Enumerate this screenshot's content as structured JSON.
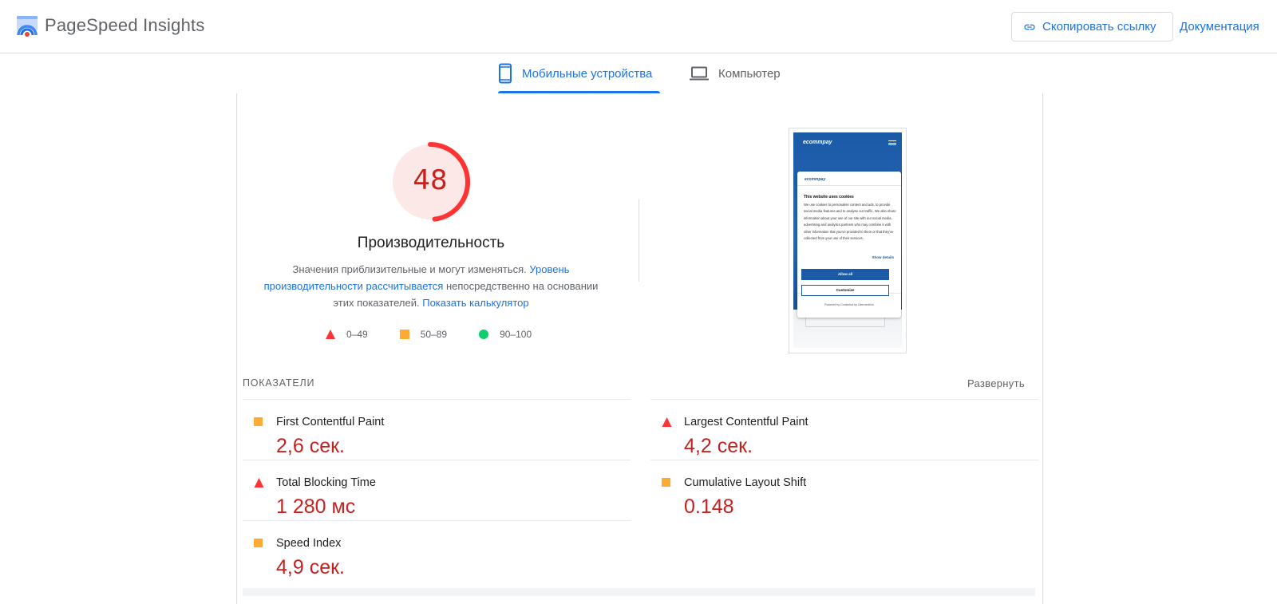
{
  "header": {
    "logo_text": "PageSpeed Insights",
    "copy_link": "Скопировать ссылку",
    "docs": "Документация"
  },
  "tabs": [
    {
      "label": "Мобильные устройства",
      "active": true,
      "icon": "phone-icon"
    },
    {
      "label": "Компьютер",
      "active": false,
      "icon": "laptop-icon"
    }
  ],
  "score": {
    "value": "48",
    "fraction": 0.48,
    "title": "Производительность",
    "desc_1": "Значения приблизительные и могут изменяться. ",
    "link_1": "Уровень производительности рассчитывается",
    "desc_2": " непосредственно на основании этих показателей. ",
    "link_2": "Показать калькулятор"
  },
  "legend": [
    {
      "label": "0–49",
      "shape": "triangle",
      "color": "#ff3333"
    },
    {
      "label": "50–89",
      "shape": "square",
      "color": "#ffaa33"
    },
    {
      "label": "90–100",
      "shape": "circle",
      "color": "#0cce6b"
    }
  ],
  "screenshot": {
    "brand": "ecommpay",
    "dialog_title": "This website uses cookies",
    "dialog_body": "We use cookies to personalise content and ads, to provide social media features and to analyse our traffic. We also share information about your use of our site with our social media, advertising and analytics partners who may combine it with other information that you've provided to them or that they've collected from your use of their services.",
    "show_details": "Show details",
    "allow_all": "Allow all",
    "customize": "Customize",
    "powered": "Powered by Cookiebot by Usercentrics"
  },
  "metrics_section": {
    "label": "ПОКАЗАТЕЛИ",
    "expand": "Развернуть"
  },
  "metrics": [
    {
      "name": "First Contentful Paint",
      "value": "2,6 сек.",
      "rating": "average"
    },
    {
      "name": "Largest Contentful Paint",
      "value": "4,2 сек.",
      "rating": "fail"
    },
    {
      "name": "Total Blocking Time",
      "value": "1 280 мс",
      "rating": "fail"
    },
    {
      "name": "Cumulative Layout Shift",
      "value": "0.148",
      "rating": "average"
    },
    {
      "name": "Speed Index",
      "value": "4,9 сек.",
      "rating": "average"
    }
  ],
  "colors": {
    "accent": "#1a73e8",
    "fail": "#ff3333",
    "average": "#ffaa33",
    "pass": "#0cce6b",
    "fail_text": "#c5221f"
  }
}
